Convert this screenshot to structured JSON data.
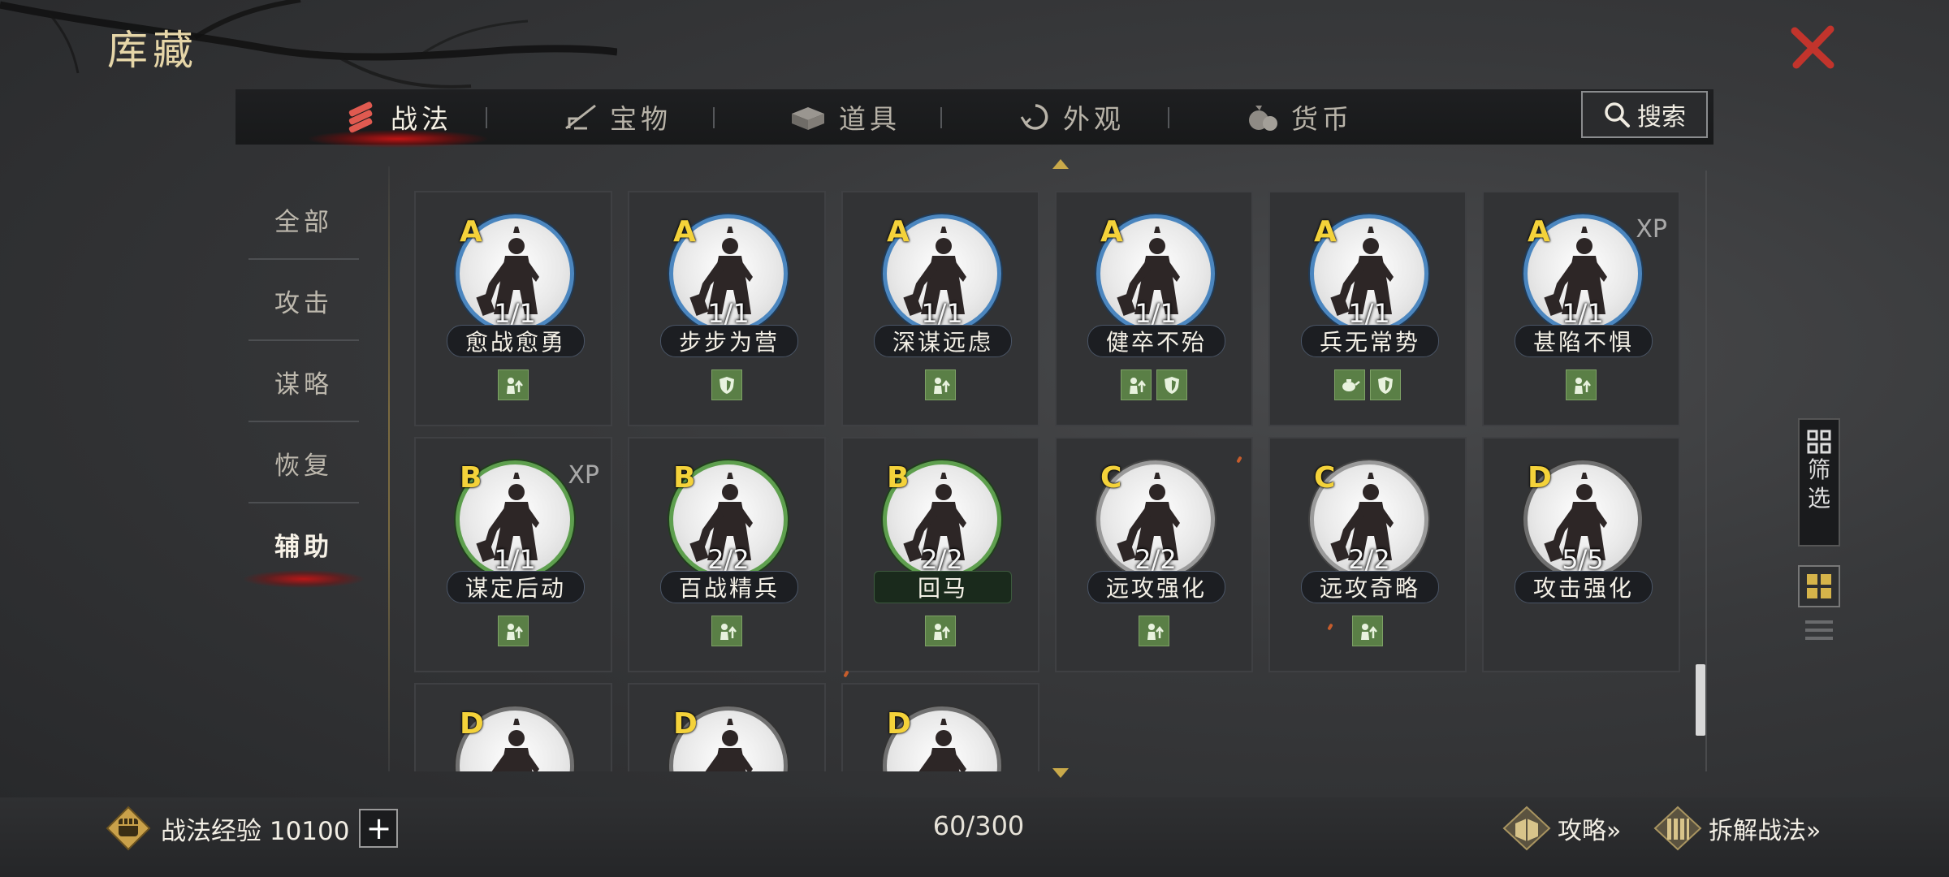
{
  "header": {
    "title": "库藏"
  },
  "tabs": [
    {
      "label": "战法",
      "icon": "scroll-bundle-icon",
      "active": true
    },
    {
      "label": "宝物",
      "icon": "treasure-icon",
      "active": false
    },
    {
      "label": "道具",
      "icon": "item-box-icon",
      "active": false
    },
    {
      "label": "外观",
      "icon": "appearance-icon",
      "active": false
    },
    {
      "label": "货币",
      "icon": "money-bag-icon",
      "active": false
    }
  ],
  "search": {
    "label": "搜索"
  },
  "categories": [
    {
      "label": "全部",
      "active": false
    },
    {
      "label": "攻击",
      "active": false
    },
    {
      "label": "谋略",
      "active": false
    },
    {
      "label": "恢复",
      "active": false
    },
    {
      "label": "辅助",
      "active": true
    }
  ],
  "cards": [
    {
      "grade": "A",
      "count": "1/1",
      "name": "愈战愈勇",
      "xp": "",
      "icons": [
        "buff-up-icon"
      ]
    },
    {
      "grade": "A",
      "count": "1/1",
      "name": "步步为营",
      "xp": "",
      "icons": [
        "shield-icon"
      ]
    },
    {
      "grade": "A",
      "count": "1/1",
      "name": "深谋远虑",
      "xp": "",
      "icons": [
        "buff-up-icon"
      ]
    },
    {
      "grade": "A",
      "count": "1/1",
      "name": "健卒不殆",
      "xp": "",
      "icons": [
        "buff-up-icon",
        "shield-icon"
      ]
    },
    {
      "grade": "A",
      "count": "1/1",
      "name": "兵无常势",
      "xp": "",
      "icons": [
        "teapot-icon",
        "shield-icon"
      ]
    },
    {
      "grade": "A",
      "count": "1/1",
      "name": "甚陷不惧",
      "xp": "XP",
      "icons": [
        "buff-up-icon"
      ]
    },
    {
      "grade": "B",
      "count": "1/1",
      "name": "谋定后动",
      "xp": "XP",
      "icons": [
        "buff-up-icon"
      ]
    },
    {
      "grade": "B",
      "count": "2/2",
      "name": "百战精兵",
      "xp": "",
      "icons": [
        "buff-up-icon"
      ]
    },
    {
      "grade": "B",
      "count": "2/2",
      "name": "回马",
      "xp": "",
      "icons": [
        "buff-up-icon"
      ]
    },
    {
      "grade": "C",
      "count": "2/2",
      "name": "远攻强化",
      "xp": "",
      "icons": [
        "buff-up-icon"
      ]
    },
    {
      "grade": "C",
      "count": "2/2",
      "name": "远攻奇略",
      "xp": "",
      "icons": [
        "buff-up-icon"
      ]
    },
    {
      "grade": "D",
      "count": "5/5",
      "name": "攻击强化",
      "xp": "",
      "icons": []
    },
    {
      "grade": "D",
      "count": "",
      "name": "",
      "xp": "",
      "icons": []
    },
    {
      "grade": "D",
      "count": "",
      "name": "",
      "xp": "",
      "icons": []
    },
    {
      "grade": "D",
      "count": "",
      "name": "",
      "xp": "",
      "icons": []
    }
  ],
  "side": {
    "filter_label_1": "筛",
    "filter_label_2": "选"
  },
  "footer": {
    "exp_label": "战法经验 10100",
    "plus_label": "+",
    "capacity": "60/300",
    "strategy_link": "攻略»",
    "dismantle_link": "拆解战法»"
  },
  "colors": {
    "grade_text": "#f4d23a",
    "A": "#4b86bf",
    "B": "#5e9f4e",
    "C": "#9a9a9a",
    "D": "#707070",
    "active_glow": "#c81414"
  }
}
